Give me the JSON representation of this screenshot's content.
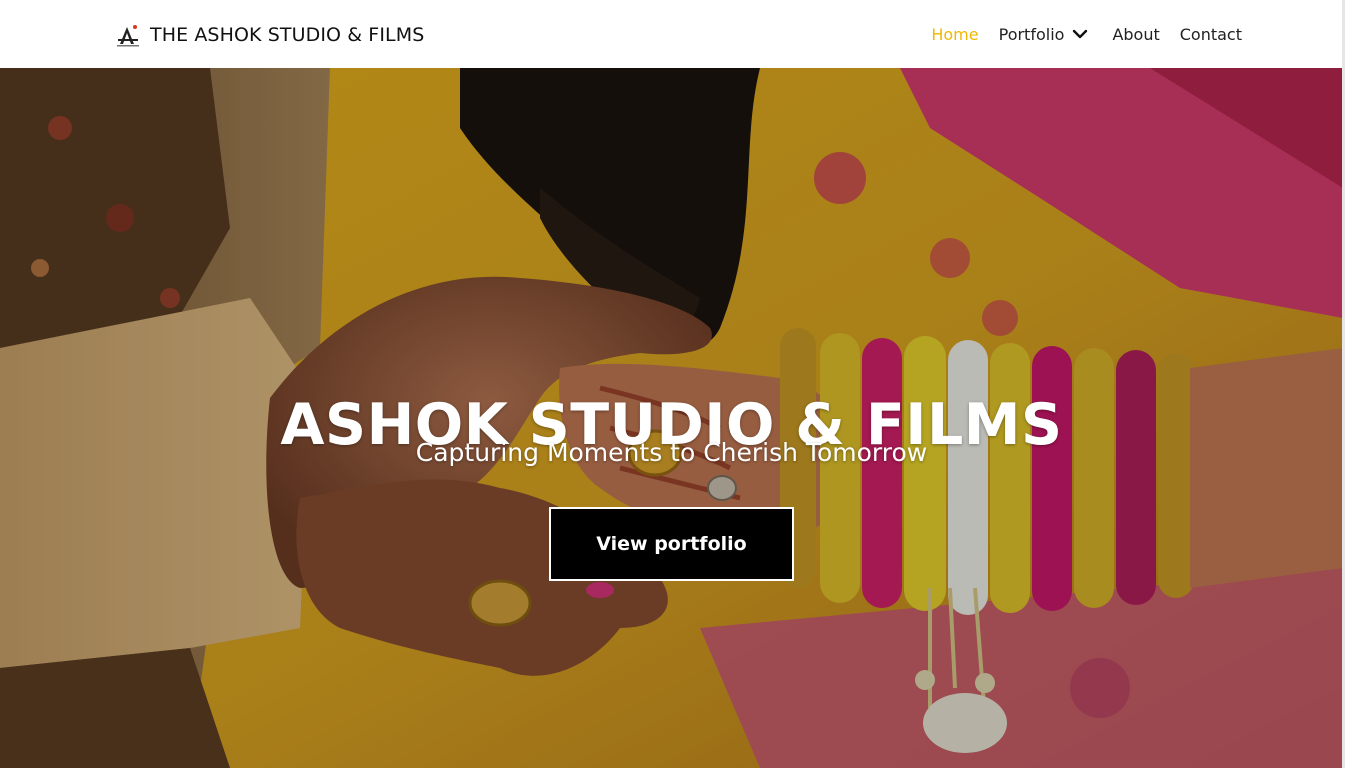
{
  "header": {
    "brand_name": "THE ASHOK STUDIO & FILMS",
    "brand_logo_icon": "camera-logo-icon",
    "nav": {
      "home": "Home",
      "portfolio": "Portfolio",
      "about": "About",
      "contact": "Contact"
    },
    "active_color": "#f2b705"
  },
  "hero": {
    "title": "ASHOK STUDIO & FILMS",
    "subtitle": "Capturing Moments to Cherish Tomorrow",
    "button_label": "View portfolio",
    "button_color": "#000000"
  }
}
